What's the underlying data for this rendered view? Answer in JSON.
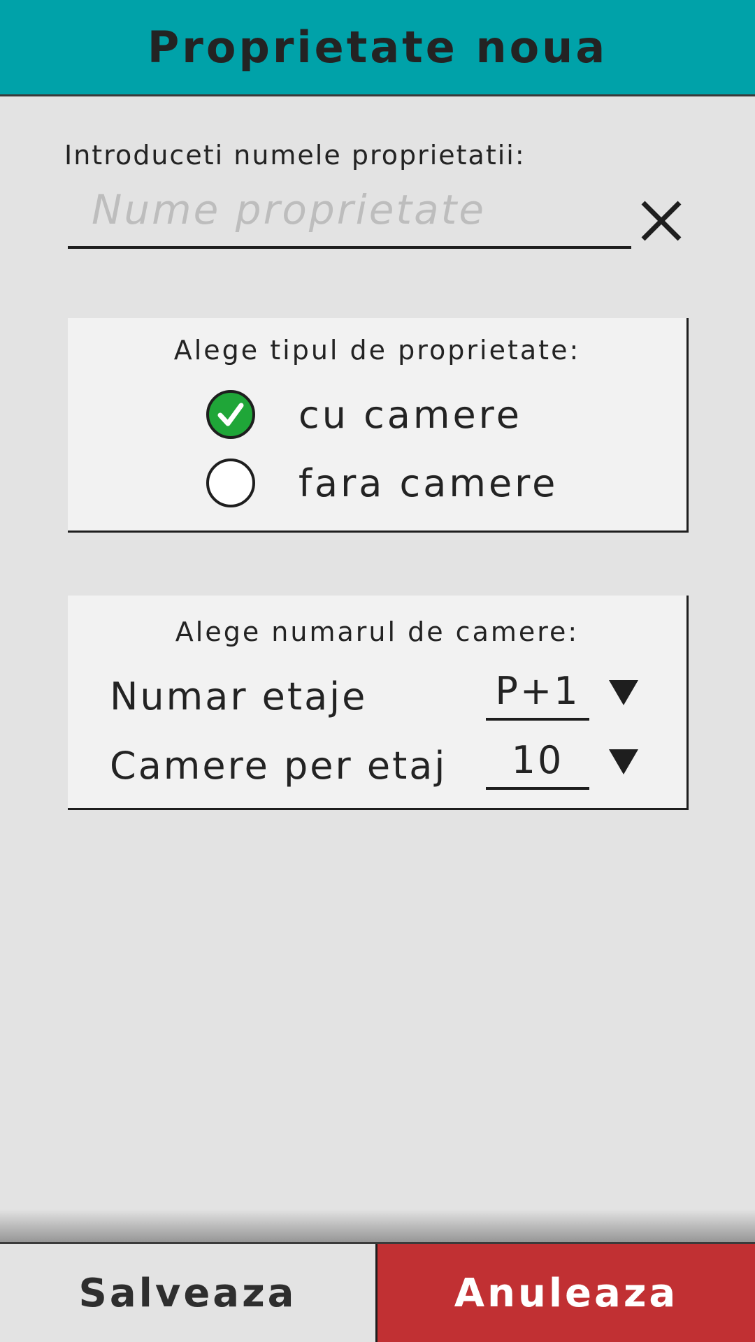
{
  "header": {
    "title": "Proprietate noua"
  },
  "name_field": {
    "label": "Introduceti numele proprietatii:",
    "value": "",
    "placeholder": "Nume proprietate",
    "clear_icon": "close-icon"
  },
  "property_type": {
    "heading": "Alege tipul de proprietate:",
    "options": [
      {
        "label": "cu camere",
        "checked": true
      },
      {
        "label": "fara camere",
        "checked": false
      }
    ],
    "checked_color": "#1fa638"
  },
  "rooms": {
    "heading": "Alege numarul de camere:",
    "fields": [
      {
        "label": "Numar etaje",
        "value": "P+1"
      },
      {
        "label": "Camere per etaj",
        "value": "10"
      }
    ]
  },
  "footer": {
    "save_label": "Salveaza",
    "cancel_label": "Anuleaza"
  },
  "colors": {
    "header": "#00a2a9",
    "cancel": "#c13033",
    "background": "#e3e3e3",
    "panel": "#f2f2f2"
  }
}
